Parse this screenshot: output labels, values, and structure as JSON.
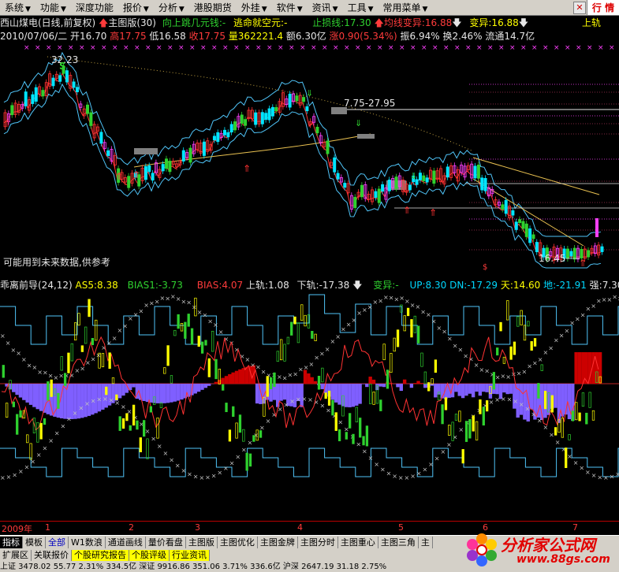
{
  "menu": {
    "items": [
      "系统",
      "功能",
      "深度功能",
      "报价",
      "分析",
      "港股期货",
      "外挂",
      "软件",
      "资讯",
      "工具",
      "常用菜单"
    ],
    "logo": "行 情"
  },
  "header": {
    "line1": {
      "stock": "西山煤电(日线,前复权)",
      "version": "主图版(30)",
      "signal": "向上跳几元钱:-",
      "escape": "逃命就空元:-",
      "stop_loss": "止损线:17.30",
      "mean_change": "均线变异:16.88",
      "variant": "变异:16.88",
      "upper_rail": "上轨"
    },
    "line2": {
      "date": "2010/07/06/二",
      "open": "开16.70",
      "high": "高17.75",
      "low": "低16.58",
      "close": "收17.75",
      "volume": "量362221.4",
      "amount": "额6.30亿",
      "change": "涨0.90(5.34%)",
      "amplitude": "振6.94%",
      "turnover": "换2.46%",
      "float": "流通14.7亿"
    }
  },
  "main_chart": {
    "labels": {
      "high_price": "32.23",
      "band": "7.75-27.95",
      "low_price": "16.45",
      "note": "可能用到未来数据,供参考",
      "buy_mark": "S",
      "down_mark": "下",
      "dollar": "$"
    }
  },
  "indicator": {
    "name": "乖离前导(24,12)",
    "as": "AS5:8.38",
    "bias1": "BIAS1:-3.73",
    "bias": "BIAS:4.07",
    "upper": "上轨:1.08",
    "lower": "下轨:-17.38",
    "variant": "变异:-",
    "up": "UP:8.30",
    "dn": "DN:-17.29",
    "sky": "天:14.60",
    "ground": "地:-21.91",
    "strong": "强:7.30"
  },
  "axis": {
    "year": "2009年",
    "months": [
      "1",
      "2",
      "3",
      "4",
      "5",
      "6",
      "7"
    ]
  },
  "tabs_row1": [
    "指标",
    "模板",
    "全部",
    "W1数浪",
    "通道画线",
    "量价看盘",
    "主图版",
    "主图优化",
    "主图金牌",
    "主图分时",
    "主图重心",
    "主图三角",
    "主"
  ],
  "tabs_row2": [
    "扩展区",
    "关联报价",
    "个股研究报告",
    "个股评级",
    "行业资讯"
  ],
  "status": "上证 3478.02  55.77  2.31%  334.5亿  深证 9916.86  351.06  3.71%  336.6亿  沪深 2647.19  31.18  2.75%",
  "watermark": {
    "title": "分析家公式网",
    "url": "www.88gs.com"
  },
  "colors": {
    "up": "#ff3232",
    "down": "#00e5ff",
    "green": "#2fd12f",
    "yellow": "#ffff00",
    "purple": "#7f5fff",
    "cyan": "#4fc3f7"
  }
}
